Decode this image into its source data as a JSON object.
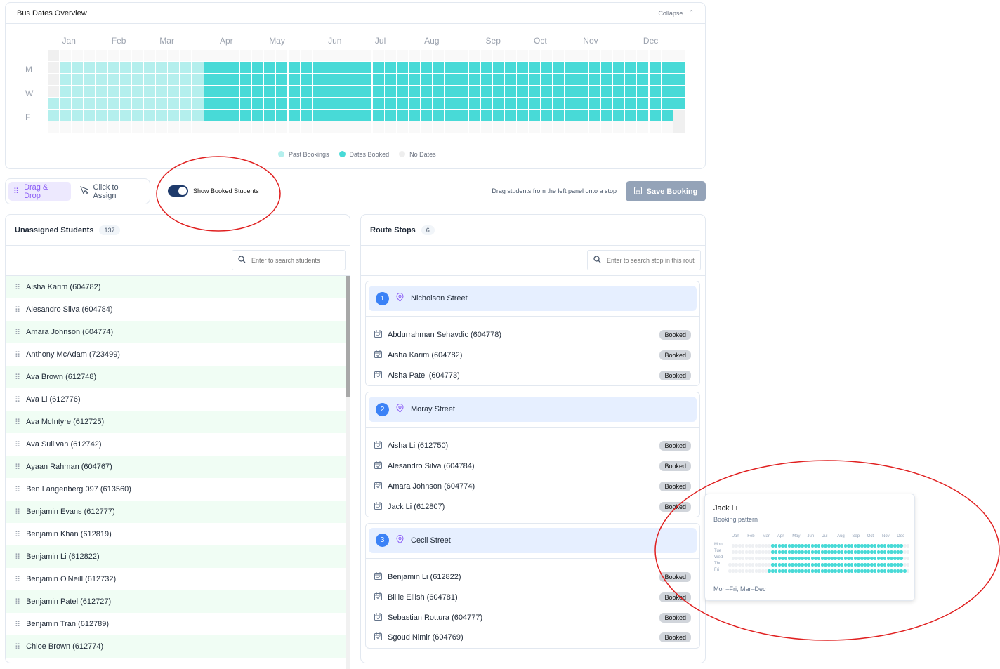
{
  "overview": {
    "title": "Bus Dates Overview",
    "collapse_label": "Collapse",
    "months": [
      "Jan",
      "Feb",
      "Mar",
      "Apr",
      "May",
      "Jun",
      "Jul",
      "Aug",
      "Sep",
      "Oct",
      "Nov",
      "Dec"
    ],
    "day_labels": [
      "M",
      "W",
      "F"
    ],
    "rows": [
      "x----------------------------------------------------",
      "x1111111111112222222222222222222222222222222222222222",
      "x1111111111112222222222222222222222222222222222222222",
      "x1111111111112222222222222222222222222222222222222222",
      "11111111111112222222222222222222222222222222222222222",
      "1111111111111222222222222222222222222222222222222222x",
      "----------------------------------------------------x"
    ],
    "legend": [
      {
        "label": "Past Bookings",
        "color": "#b4efed"
      },
      {
        "label": "Dates Booked",
        "color": "#48dad7"
      },
      {
        "label": "No Dates",
        "color": "#eeeeee"
      }
    ]
  },
  "toolbar": {
    "drag_drop": "Drag & Drop",
    "click_assign": "Click to Assign",
    "toggle_label": "Show Booked Students",
    "toggle_on": true,
    "hint": "Drag students from the left panel onto a stop",
    "save": "Save Booking"
  },
  "left": {
    "title": "Unassigned Students",
    "count": "137",
    "search_placeholder": "Enter to search students",
    "students": [
      "Aisha Karim (604782)",
      "Alesandro Silva (604784)",
      "Amara Johnson (604774)",
      "Anthony McAdam (723499)",
      "Ava Brown (612748)",
      "Ava Li (612776)",
      "Ava McIntyre (612725)",
      "Ava Sullivan (612742)",
      "Ayaan Rahman (604767)",
      "Ben Langenberg 097 (613560)",
      "Benjamin Evans (612777)",
      "Benjamin Khan (612819)",
      "Benjamin Li (612822)",
      "Benjamin O'Neill (612732)",
      "Benjamin Patel (612727)",
      "Benjamin Tran (612789)",
      "Chloe Brown (612774)"
    ]
  },
  "right": {
    "title": "Route Stops",
    "count": "6",
    "search_placeholder": "Enter to search stop in this route",
    "booked_label": "Booked",
    "stops": [
      {
        "num": "1",
        "name": "Nicholson Street",
        "students": [
          "Abdurrahman Sehavdic (604778)",
          "Aisha Karim (604782)",
          "Aisha Patel (604773)"
        ]
      },
      {
        "num": "2",
        "name": "Moray Street",
        "students": [
          "Aisha Li (612750)",
          "Alesandro Silva (604784)",
          "Amara Johnson (604774)",
          "Jack Li (612807)"
        ]
      },
      {
        "num": "3",
        "name": "Cecil Street",
        "students": [
          "Benjamin Li (612822)",
          "Billie Ellish (604781)",
          "Sebastian Rottura (604777)",
          "Sgoud Nimir (604769)"
        ]
      }
    ]
  },
  "tooltip": {
    "name": "Jack Li",
    "subtitle": "Booking pattern",
    "days": [
      "Mon",
      "Tue",
      "Wed",
      "Thu",
      "Fri"
    ],
    "months": [
      "Jan",
      "Feb",
      "Mar",
      "Apr",
      "May",
      "Jun",
      "Jul",
      "Aug",
      "Sep",
      "Oct",
      "Nov",
      "Dec"
    ],
    "rows": [
      "-000000000000222222222222222222222222222222222222222200",
      "-000000000000222222222222222222222222222222222222222200",
      "-000000000000222222222222222222222222222222222222222200",
      "0000000000000222222222222222222222222222222222222222200",
      "0000000000002222222222222222222222222222222222222222220"
    ],
    "summary": "Mon–Fri, Mar–Dec"
  }
}
